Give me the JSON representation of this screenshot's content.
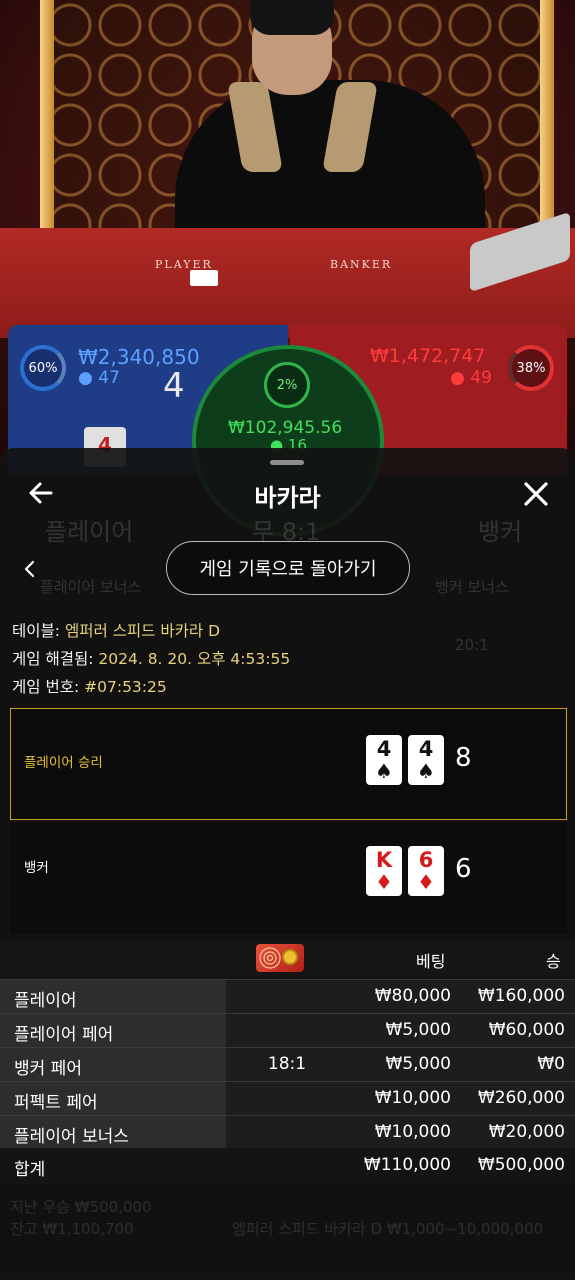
{
  "video": {
    "felt_player": "PLAYER",
    "felt_banker": "BANKER",
    "player_pct": "60%",
    "player_amount": "₩2,340,850",
    "player_count": "47",
    "player_score": "4",
    "banker_pct": "38%",
    "banker_amount": "₩1,472,747",
    "banker_count": "49",
    "tie_pct": "2%",
    "tie_amount": "₩102,945.56",
    "tie_count": "16",
    "blue_card": "4"
  },
  "ghost": {
    "player": "플레이어",
    "tie": "무 8:1",
    "banker": "뱅커",
    "player_bonus": "플레이어 보너스",
    "banker_bonus": "뱅커 보너스",
    "odds_20": "20:1",
    "footer_win": "지난 우승 ₩500,000",
    "footer_balance": "잔고 ₩1,100,700",
    "footer_table": "엠퍼러 스피드 바카라 D  ₩1,000~10,000,000"
  },
  "header": {
    "title": "바카라"
  },
  "back_button": "게임 기록으로 돌아가기",
  "info": {
    "table_label": "테이블:",
    "table_value": "엠퍼러 스피드 바카라 D",
    "resolved_label": "게임 해결됨:",
    "resolved_value": "2024. 8. 20. 오후 4:53:55",
    "game_no_label": "게임 번호:",
    "game_no_value": "#07:53:25"
  },
  "result": {
    "player": {
      "label": "플레이어 승리",
      "cards": [
        {
          "rank": "4",
          "suit": "♠",
          "color": "#111111"
        },
        {
          "rank": "4",
          "suit": "♠",
          "color": "#111111"
        }
      ],
      "score": "8"
    },
    "banker": {
      "label": "뱅커",
      "cards": [
        {
          "rank": "K",
          "suit": "♦",
          "color": "#d61b1b"
        },
        {
          "rank": "6",
          "suit": "♦",
          "color": "#d61b1b"
        }
      ],
      "score": "6"
    }
  },
  "bets": {
    "col_bet": "베팅",
    "col_win": "승",
    "rows": [
      {
        "name": "플레이어",
        "odds": "",
        "bet": "₩80,000",
        "win": "₩160,000"
      },
      {
        "name": "플레이어 페어",
        "odds": "",
        "bet": "₩5,000",
        "win": "₩60,000"
      },
      {
        "name": "뱅커 페어",
        "odds": "18:1",
        "bet": "₩5,000",
        "win": "₩0"
      },
      {
        "name": "퍼펙트 페어",
        "odds": "",
        "bet": "₩10,000",
        "win": "₩260,000"
      },
      {
        "name": "플레이어 보너스",
        "odds": "",
        "bet": "₩10,000",
        "win": "₩20,000"
      }
    ],
    "total": {
      "name": "합계",
      "bet": "₩110,000",
      "win": "₩500,000"
    }
  },
  "colors": {
    "accent_gold": "#c9a21b",
    "player_blue": "#1f3d86",
    "banker_red": "#9f1d20",
    "tie_green": "#1b8a3a"
  }
}
